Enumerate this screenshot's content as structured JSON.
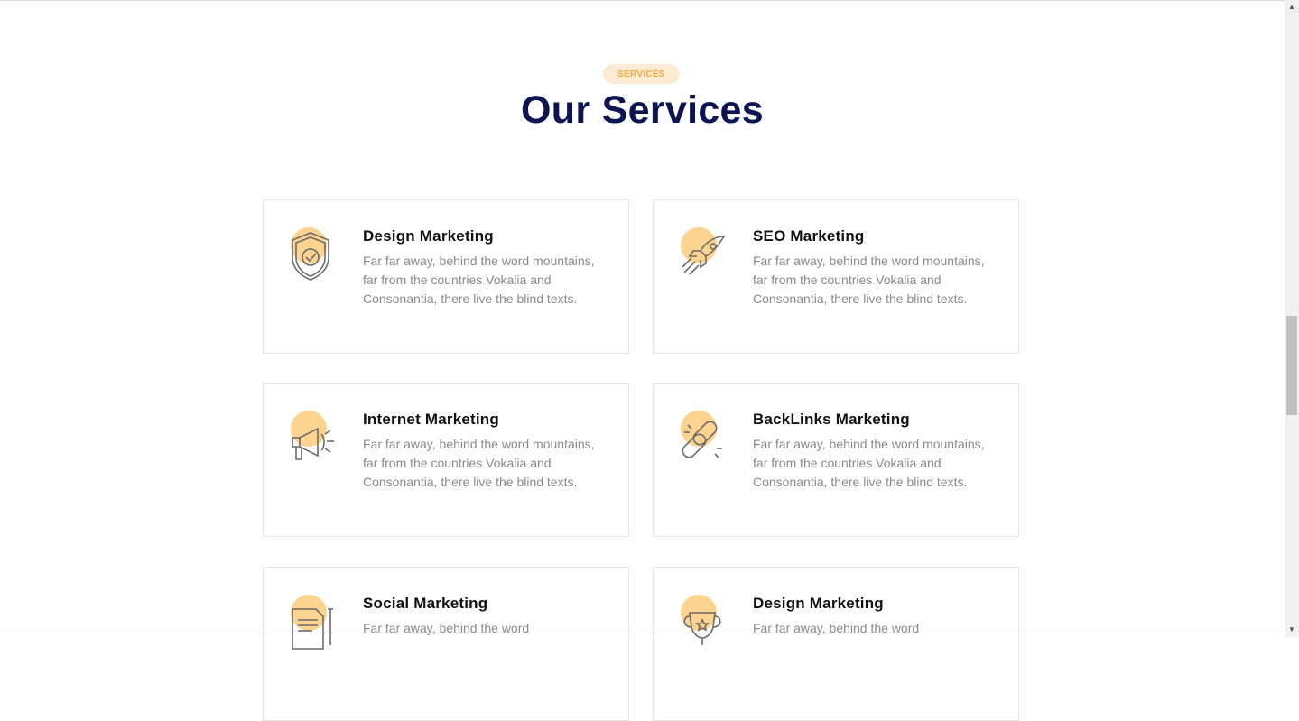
{
  "section": {
    "badge": "SERVICES",
    "title": "Our Services"
  },
  "services": [
    {
      "title": "Design Marketing",
      "text": "Far far away, behind the word mountains, far from the countries Vokalia and Consonantia, there live the blind texts.",
      "icon": "shield-check-icon"
    },
    {
      "title": "SEO Marketing",
      "text": "Far far away, behind the word mountains, far from the countries Vokalia and Consonantia, there live the blind texts.",
      "icon": "rocket-icon"
    },
    {
      "title": "Internet Marketing",
      "text": "Far far away, behind the word mountains, far from the countries Vokalia and Consonantia, there live the blind texts.",
      "icon": "megaphone-icon"
    },
    {
      "title": "BackLinks Marketing",
      "text": "Far far away, behind the word mountains, far from the countries Vokalia and Consonantia, there live the blind texts.",
      "icon": "chain-link-icon"
    },
    {
      "title": "Social Marketing",
      "text": "Far far away, behind the word",
      "icon": "document-pen-icon"
    },
    {
      "title": "Design Marketing",
      "text": "Far far away, behind the word",
      "icon": "trophy-icon"
    }
  ],
  "colors": {
    "accent": "#f3a83b",
    "accent_light": "#fcd38f",
    "badge_bg": "#fdebd3",
    "title": "#0d1452",
    "body_text": "#8a8a8a"
  }
}
